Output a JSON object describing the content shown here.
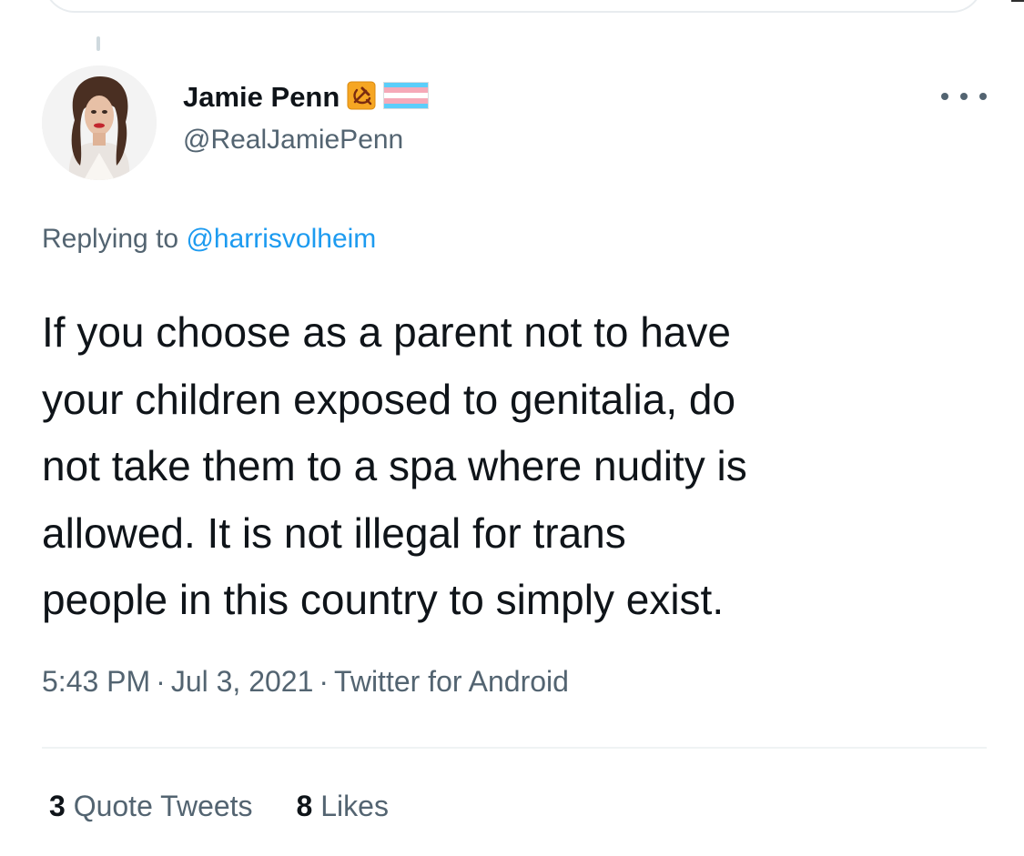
{
  "tweet": {
    "author": {
      "display_name": "Jamie Penn",
      "handle": "@RealJamiePenn",
      "badges": [
        "hammer-sickle-emoji-icon",
        "transgender-flag-emoji-icon"
      ]
    },
    "reply_context": {
      "prefix": "Replying to",
      "handle": "@harrisvolheim"
    },
    "text_lines": [
      "If you choose as a parent not to have",
      "your children exposed to genitalia, do",
      "not take them to a spa where nudity is",
      "allowed. It is not illegal for trans",
      "people in this country to simply exist."
    ],
    "time": "5:43 PM",
    "date": "Jul 3, 2021",
    "source": "Twitter for Android",
    "separator": "·",
    "stats": {
      "quote_tweets_count": "3",
      "quote_tweets_label": "Quote Tweets",
      "likes_count": "8",
      "likes_label": "Likes"
    }
  },
  "colors": {
    "text_primary": "#0f1419",
    "text_secondary": "#536471",
    "link": "#1d9bf0",
    "divider": "#eff3f4",
    "background": "#ffffff"
  }
}
